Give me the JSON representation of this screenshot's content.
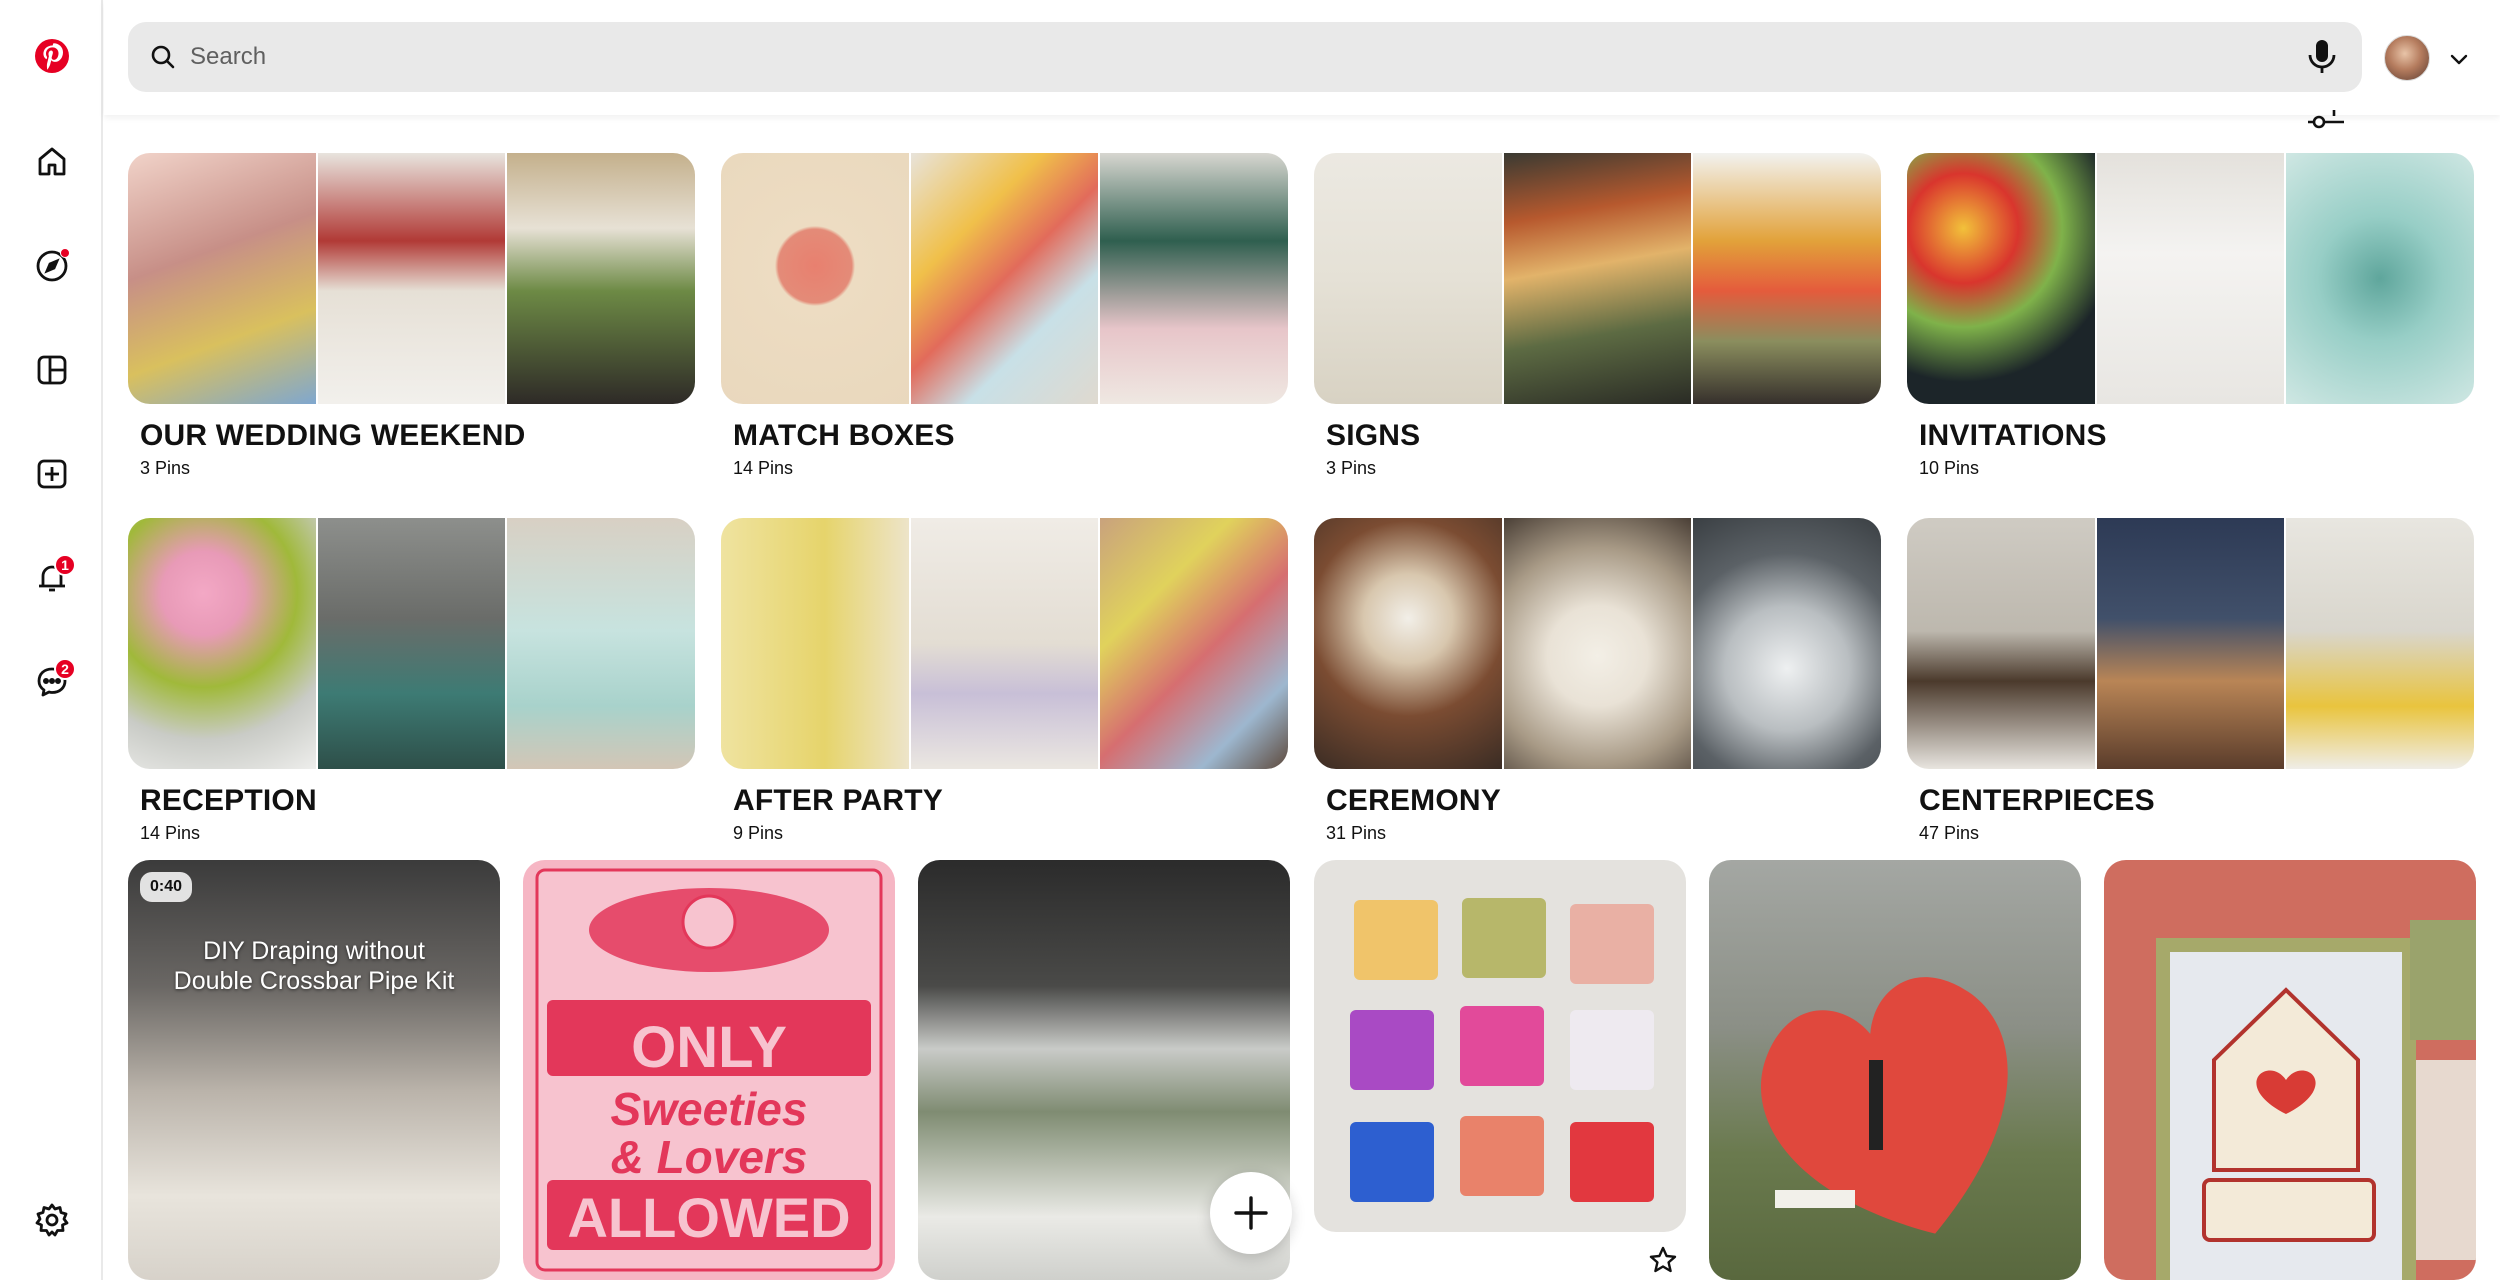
{
  "app": {
    "brand_color": "#e60023"
  },
  "rail": {
    "logo_icon": "pinterest-logo",
    "items": [
      {
        "name": "home-icon"
      },
      {
        "name": "explore-icon",
        "dot": true
      },
      {
        "name": "boards-icon"
      },
      {
        "name": "create-icon"
      },
      {
        "name": "notifications-icon",
        "badge": "1"
      },
      {
        "name": "messages-icon",
        "badge": "2"
      }
    ],
    "settings_icon": "gear-icon"
  },
  "header": {
    "search_placeholder": "Search"
  },
  "boards": [
    {
      "title": "OUR WEDDING WEEKEND",
      "count": "3",
      "unit": "Pins",
      "colors": [
        "#d9b7ac",
        "#ece8e2",
        "#7b8d52"
      ]
    },
    {
      "title": "MATCH BOXES",
      "count": "14",
      "unit": "Pins",
      "colors": [
        "#ead9c0",
        "#dcd4c6",
        "#cfcfc9"
      ]
    },
    {
      "title": "SIGNS",
      "count": "3",
      "unit": "Pins",
      "colors": [
        "#e6e2d8",
        "#8a5a3a",
        "#4d3f3a"
      ]
    },
    {
      "title": "INVITATIONS",
      "count": "10",
      "unit": "Pins",
      "colors": [
        "#1b2a2f",
        "#e9e6e1",
        "#8fc9c2"
      ]
    },
    {
      "title": "RECEPTION",
      "count": "14",
      "unit": "Pins",
      "colors": [
        "#c8d199",
        "#6d7471",
        "#b9d6d1"
      ]
    },
    {
      "title": "AFTER PARTY",
      "count": "9",
      "unit": "Pins",
      "colors": [
        "#e6cf72",
        "#e9e2dc",
        "#c9a78c"
      ]
    },
    {
      "title": "CEREMONY",
      "count": "31",
      "unit": "Pins",
      "colors": [
        "#6d4a34",
        "#d8d1c5",
        "#575e63"
      ]
    },
    {
      "title": "CENTERPIECES",
      "count": "47",
      "unit": "Pins",
      "colors": [
        "#c7c2b8",
        "#38465c",
        "#dedbd2"
      ]
    }
  ],
  "pins": [
    {
      "kind": "video",
      "duration": "0:40",
      "caption_line1": "DIY Draping without",
      "caption_line2": "Double Crossbar Pipe Kit",
      "color": "#8a8580"
    },
    {
      "kind": "image",
      "line1": "ONLY",
      "line2": "Sweeties",
      "line3": "& Lovers",
      "line4": "ALLOWED",
      "color": "#f6b7c4"
    },
    {
      "kind": "image",
      "color": "#6f746c"
    },
    {
      "kind": "image",
      "color": "#d8d6d2"
    },
    {
      "kind": "image",
      "color": "#7b8270"
    },
    {
      "kind": "image",
      "color": "#cf6d5f"
    }
  ]
}
